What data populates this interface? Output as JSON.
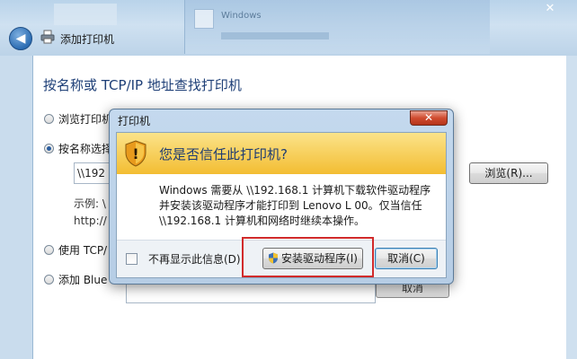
{
  "background_window": {
    "title_fragment": "Windows"
  },
  "wizard": {
    "title": "添加打印机",
    "heading": "按名称或 TCP/IP 地址查找打印机",
    "options": [
      {
        "label": "浏览打印机",
        "selected": false
      },
      {
        "label": "按名称选择",
        "selected": true
      },
      {
        "label": "使用 TCP/",
        "selected": false
      },
      {
        "label": "添加 Blue",
        "selected": false
      }
    ],
    "input_value": "\\\\192",
    "example_label": "示例: \\",
    "example_url": "http://",
    "browse_label": "浏览(R)...",
    "cancel_label": "取消"
  },
  "dialog": {
    "title": "打印机",
    "close_label": "✕",
    "warning": "您是否信任此打印机?",
    "message_lines": [
      "Windows 需要从 \\\\192.168.1   计算机下载软件驱动程序",
      "并安装该驱动程序才能打印到 Lenovo L      00。仅当信任",
      "\\\\192.168.1    计算机和网络时继续本操作。"
    ],
    "checkbox_label": "不再显示此信息(D)",
    "install_label": "安装驱动程序(I)",
    "cancel_label": "取消(C)"
  },
  "colors": {
    "warning_band": "#f3bd32",
    "highlight_box": "#d12b2b",
    "heading_blue": "#1e3f77"
  },
  "icons": [
    "back-arrow-icon",
    "printer-icon",
    "shield-warning-icon",
    "uac-shield-icon",
    "close-icon"
  ]
}
